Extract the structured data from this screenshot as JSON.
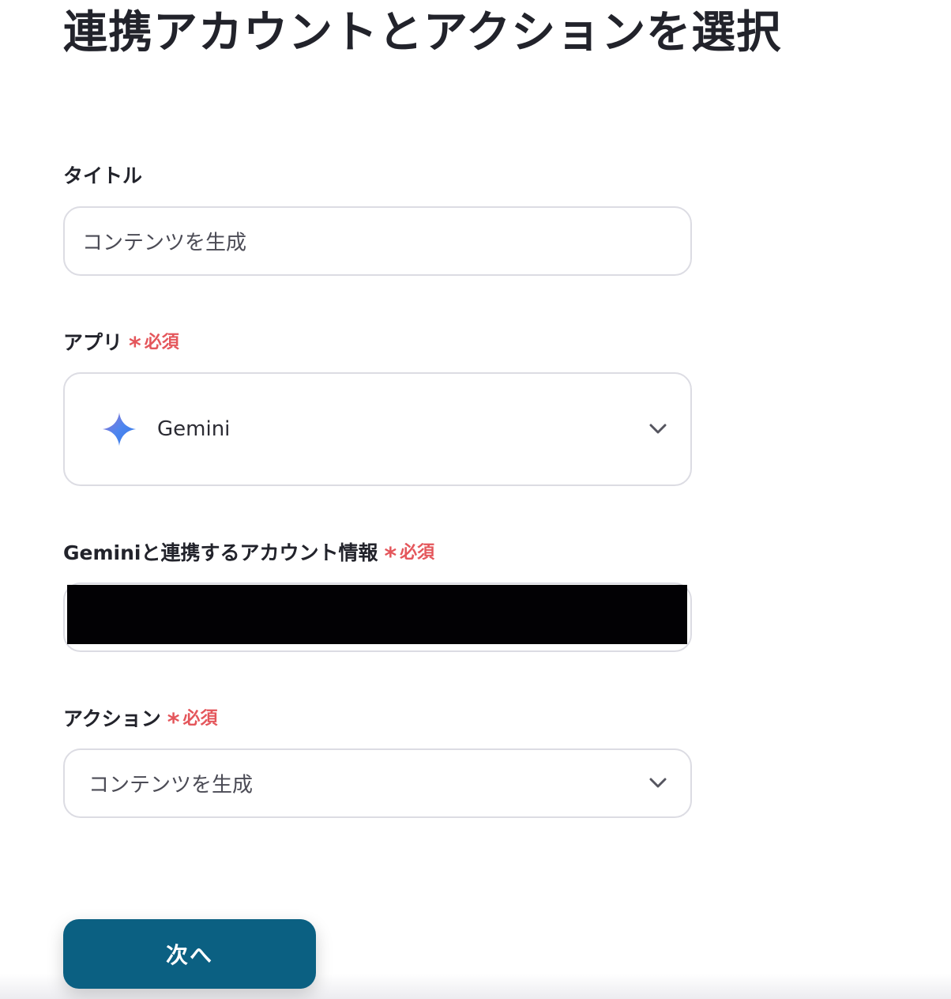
{
  "page": {
    "title": "連携アカウントとアクションを選択"
  },
  "required_text": "必須",
  "title_field": {
    "label": "タイトル",
    "value": "コンテンツを生成"
  },
  "app_field": {
    "label": "アプリ",
    "value": "Gemini",
    "icon": "gemini-sparkle-icon"
  },
  "account_field": {
    "label": "Geminiと連携するアカウント情報",
    "value_redacted": true
  },
  "action_field": {
    "label": "アクション",
    "value": "コンテンツを生成"
  },
  "next_button": {
    "label": "次へ"
  },
  "colors": {
    "primary": "#0b6082",
    "required": "#e4565b",
    "border": "#dcdce3",
    "text": "#22232b"
  }
}
